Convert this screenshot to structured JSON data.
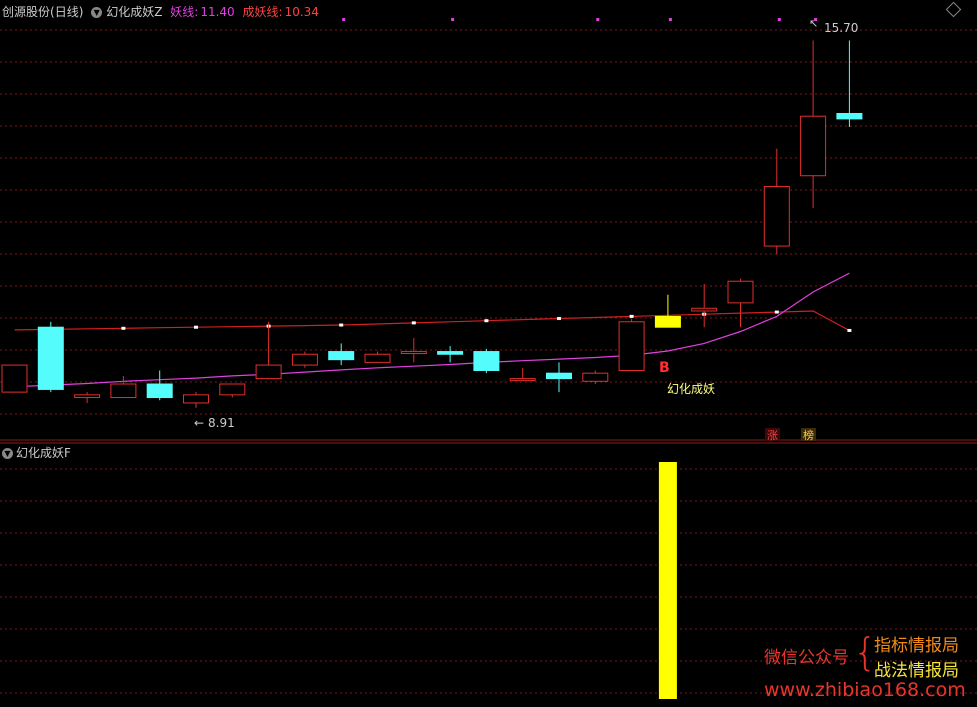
{
  "header": {
    "stock": "创源股份",
    "period": "(日线)",
    "indicator": "幻化成妖Z",
    "line1_label": "妖线:",
    "line1_value": "11.40",
    "line2_label": "成妖线:",
    "line2_value": "10.34"
  },
  "sub_header": {
    "indicator": "幻化成妖F"
  },
  "annotations": {
    "high": "15.70",
    "low": "8.91",
    "signal_letter": "B",
    "signal_text": "幻化成妖",
    "tag_zhang": "涨",
    "tag_bang": "榜"
  },
  "watermark": {
    "wechat": "微信公众号",
    "brace": "{",
    "name1": "指标情报局",
    "name2": "战法情报局",
    "url": "www.zhibiao168.com"
  },
  "colors": {
    "up": "#e0302a",
    "down": "#54fcfc",
    "signal": "#ffff00",
    "yaoxian": "#e040e0",
    "chengyao": "#d02020",
    "grid": "#7a1a1a"
  },
  "chart_data": {
    "type": "candlestick",
    "y_price_range": [
      8.5,
      16.3
    ],
    "candles": [
      {
        "o": 9.2,
        "h": 9.7,
        "l": 9.2,
        "c": 9.7
      },
      {
        "o": 10.4,
        "h": 10.5,
        "l": 9.2,
        "c": 9.25
      },
      {
        "o": 9.1,
        "h": 9.2,
        "l": 9.0,
        "c": 9.15
      },
      {
        "o": 9.1,
        "h": 9.5,
        "l": 9.1,
        "c": 9.35
      },
      {
        "o": 9.35,
        "h": 9.6,
        "l": 9.05,
        "c": 9.1
      },
      {
        "o": 9.0,
        "h": 9.2,
        "l": 8.91,
        "c": 9.15
      },
      {
        "o": 9.15,
        "h": 9.35,
        "l": 9.1,
        "c": 9.35
      },
      {
        "o": 9.45,
        "h": 10.5,
        "l": 9.45,
        "c": 9.7
      },
      {
        "o": 9.7,
        "h": 9.95,
        "l": 9.65,
        "c": 9.9
      },
      {
        "o": 9.95,
        "h": 10.1,
        "l": 9.7,
        "c": 9.8
      },
      {
        "o": 9.75,
        "h": 9.95,
        "l": 9.75,
        "c": 9.9
      },
      {
        "o": 9.95,
        "h": 10.2,
        "l": 9.75,
        "c": 9.95
      },
      {
        "o": 9.95,
        "h": 10.05,
        "l": 9.75,
        "c": 9.9
      },
      {
        "o": 9.95,
        "h": 10.0,
        "l": 9.55,
        "c": 9.6
      },
      {
        "o": 9.42,
        "h": 9.65,
        "l": 9.42,
        "c": 9.45
      },
      {
        "o": 9.55,
        "h": 9.75,
        "l": 9.2,
        "c": 9.45
      },
      {
        "o": 9.4,
        "h": 9.6,
        "l": 9.35,
        "c": 9.55
      },
      {
        "o": 9.6,
        "h": 10.55,
        "l": 9.6,
        "c": 10.5
      },
      {
        "o": 10.4,
        "h": 11.0,
        "l": 10.4,
        "c": 10.6,
        "signal": true
      },
      {
        "o": 10.7,
        "h": 11.2,
        "l": 10.4,
        "c": 10.75
      },
      {
        "o": 10.85,
        "h": 11.3,
        "l": 10.4,
        "c": 11.25
      },
      {
        "o": 11.9,
        "h": 13.7,
        "l": 11.75,
        "c": 13.0
      },
      {
        "o": 13.2,
        "h": 15.7,
        "l": 12.6,
        "c": 14.3
      },
      {
        "o": 14.35,
        "h": 15.7,
        "l": 14.1,
        "c": 14.25
      }
    ],
    "yaoxian": [
      9.3,
      9.33,
      9.36,
      9.4,
      9.43,
      9.46,
      9.5,
      9.53,
      9.57,
      9.61,
      9.65,
      9.68,
      9.71,
      9.75,
      9.78,
      9.81,
      9.84,
      9.88,
      9.96,
      10.1,
      10.32,
      10.6,
      11.05,
      11.4
    ],
    "chengyao": [
      10.35,
      10.36,
      10.37,
      10.38,
      10.39,
      10.4,
      10.41,
      10.42,
      10.43,
      10.44,
      10.46,
      10.48,
      10.5,
      10.52,
      10.54,
      10.56,
      10.58,
      10.6,
      10.62,
      10.64,
      10.66,
      10.68,
      10.7,
      10.34
    ],
    "sub_bars": [
      0,
      0,
      0,
      0,
      0,
      0,
      0,
      0,
      0,
      0,
      0,
      0,
      0,
      0,
      0,
      0,
      0,
      0,
      1,
      0,
      0,
      0,
      0,
      0
    ]
  }
}
